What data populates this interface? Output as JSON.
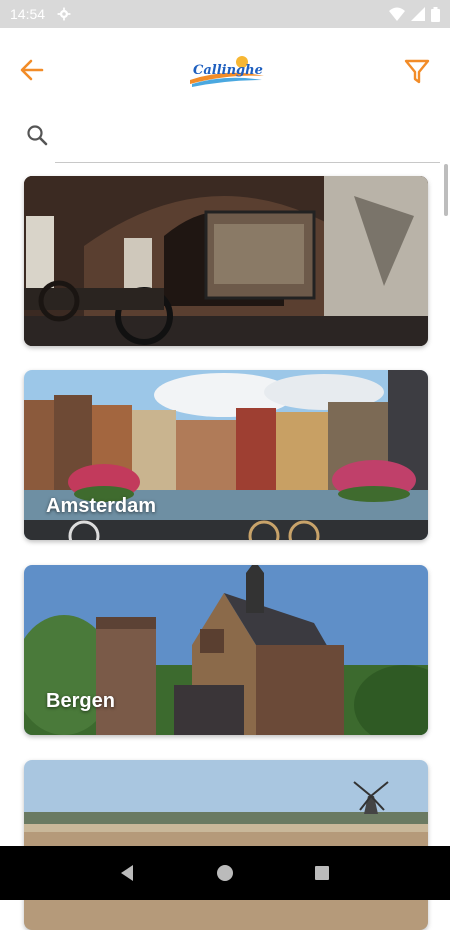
{
  "status_bar": {
    "time": "14:54"
  },
  "app_bar": {
    "logo_text": "Callinghe"
  },
  "search": {
    "placeholder": ""
  },
  "cards": [
    {
      "label": ""
    },
    {
      "label": "Amsterdam"
    },
    {
      "label": "Bergen"
    },
    {
      "label": ""
    }
  ],
  "colors": {
    "accent": "#f28c28",
    "logo_blue": "#1e5fbf"
  }
}
